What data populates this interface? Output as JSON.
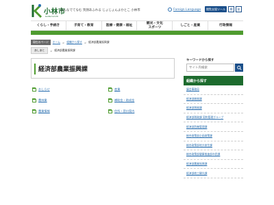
{
  "header": {
    "logo_text": "小林市",
    "logo_sub": "KOBAYASHI",
    "slogan": "みんなでてなむ 笑顔あふれる じょじょんよかとこ 小林市",
    "foreign_language": "Foreign Language",
    "tools": {
      "reading": "閲覧支援ツール",
      "text_small": "標",
      "text_large": "拡"
    }
  },
  "nav": [
    {
      "label": "くらし・手続き"
    },
    {
      "label": "子育て・教育"
    },
    {
      "label": "医療・健康・福祉"
    },
    {
      "label": "観光・文化\nスポーツ"
    },
    {
      "label": "しごと・産業"
    },
    {
      "label": "行政情報"
    }
  ],
  "breadcrumb": {
    "label": "現在のページ",
    "items": [
      "ホーム",
      "組織から探す"
    ],
    "current": "経済部農業振興課"
  },
  "breadcrumb2": {
    "label": "あしあと",
    "current": "経済部農業振興課"
  },
  "page_title": "経済部農業振興課",
  "links": [
    {
      "label": "おしらせ"
    },
    {
      "label": "産業"
    },
    {
      "label": "農林業"
    },
    {
      "label": "補助金・助成金"
    },
    {
      "label": "農業情報"
    },
    {
      "label": "住所・窓口案内"
    }
  ],
  "search": {
    "label": "キーワードから探す",
    "placeholder": "サイト内検索"
  },
  "side": {
    "heading": "組織から探す",
    "items": [
      "議会事務局",
      "経済部総務課",
      "経済部税務課",
      "経済部税務課 契約管理グループ",
      "経済部危機管理課",
      "総合政策部企画政策課",
      "総合政策部地方創生課",
      "総合政策部健康推進部市民課",
      "経済部農業振興課",
      "経済部商工観光課"
    ]
  },
  "colors": {
    "accent_green": "#4e9b2f",
    "dark_green": "#1d6b2e",
    "navy": "#1b4f8a",
    "link_blue": "#2a6fb0"
  }
}
